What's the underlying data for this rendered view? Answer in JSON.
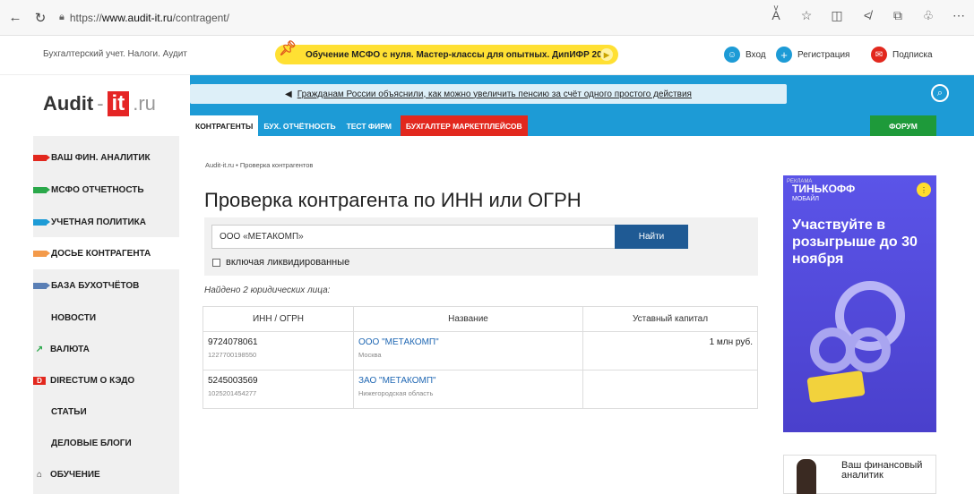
{
  "browser": {
    "url_prefix": "https://",
    "url_host": "www.audit-it.ru",
    "url_path": "/contragent/"
  },
  "topbar": {
    "tagline": "Бухгалтерский учет. Налоги. Аудит",
    "promo": "Обучение МСФО с нуля. Мастер-классы для опытных. ДипИФР 2024",
    "login": "Вход",
    "register": "Регистрация",
    "subscribe": "Подписка"
  },
  "logo": {
    "part1": "Audit",
    "sep": "-",
    "part2": "it",
    "part3": ".ru"
  },
  "notice": "Гражданам России объяснили, как можно увеличить пенсию за счёт одного простого действия",
  "tabs": [
    "КОНТРАГЕНТЫ",
    "БУХ. ОТЧЁТНОСТЬ",
    "ТЕСТ ФИРМ",
    "БУХГАЛТЕР МАРКЕТПЛЕЙСОВ"
  ],
  "forum": "ФОРУМ",
  "sidebar": [
    {
      "label": "ВАШ ФИН. АНАЛИТИК",
      "tag_color": "#e2281e"
    },
    {
      "label": "МСФО ОТЧЕТНОСТЬ",
      "tag_color": "#2aa84a"
    },
    {
      "label": "УЧЕТНАЯ ПОЛИТИКА",
      "tag_color": "#1d9bd6"
    },
    {
      "label": "ДОСЬЕ КОНТРАГЕНТА",
      "tag_color": "#f39a4a"
    },
    {
      "label": "БАЗА БУХОТЧЁТОВ",
      "tag_color": "#5a7fb5"
    },
    {
      "label": "НОВОСТИ"
    },
    {
      "label": "ВАЛЮТА",
      "icon": "chart-icon"
    },
    {
      "label": "DIRECTUM О КЭДО",
      "icon": "directum-icon"
    },
    {
      "label": "СТАТЬИ"
    },
    {
      "label": "ДЕЛОВЫЕ БЛОГИ"
    },
    {
      "label": "ОБУЧЕНИЕ",
      "icon": "graduation-icon"
    }
  ],
  "breadcrumb": "Audit-it.ru • Проверка контрагентов",
  "title": "Проверка контрагента по ИНН или ОГРН",
  "search": {
    "value": "ООО «МЕТАКОМП»",
    "button": "Найти",
    "checkbox_label": "включая ликвидированные"
  },
  "found_text": "Найдено 2 юридических лица:",
  "table": {
    "headers": [
      "ИНН / ОГРН",
      "Название",
      "Уставный капитал"
    ],
    "rows": [
      {
        "inn": "9724078061",
        "ogrn": "1227700198550",
        "name": "ООО \"МЕТАКОМП\"",
        "region": "Москва",
        "capital": "1 млн руб."
      },
      {
        "inn": "5245003569",
        "ogrn": "1025201454277",
        "name": "ЗАО \"МЕТАКОМП\"",
        "region": "Нижегородская область",
        "capital": ""
      }
    ]
  },
  "ad": {
    "label": "РЕКЛАМА",
    "brand": "ТИНЬКОФФ",
    "brand_sub": "МОБАЙЛ",
    "headline": "Участвуйте в розыгрыше до 30 ноября"
  },
  "analyst_box": "Ваш финансовый аналитик"
}
